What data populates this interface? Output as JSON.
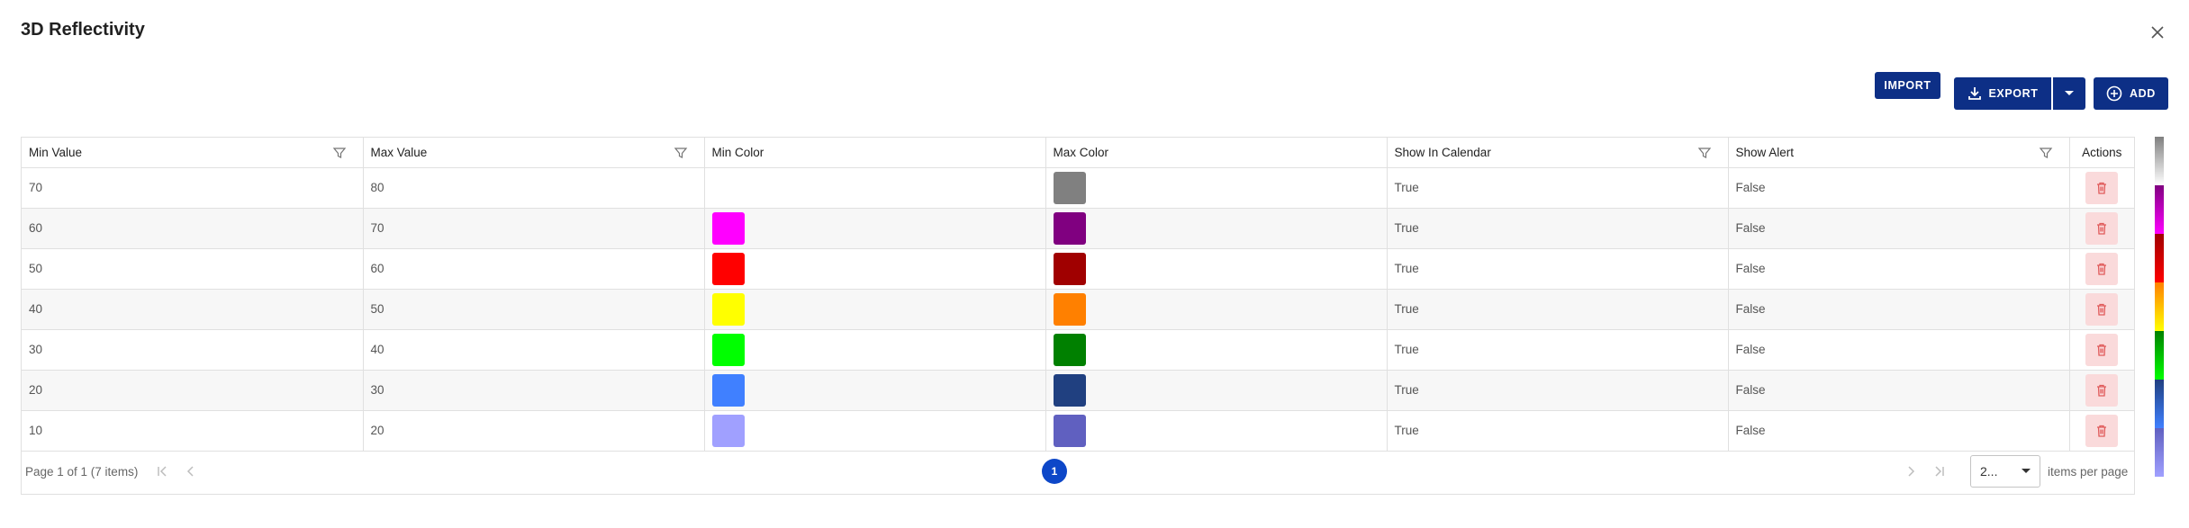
{
  "dialog": {
    "title": "3D Reflectivity"
  },
  "toolbar": {
    "import_label": "IMPORT",
    "export_label": "EXPORT",
    "add_label": "ADD"
  },
  "table": {
    "columns": [
      "Min Value",
      "Max Value",
      "Min Color",
      "Max Color",
      "Show In Calendar",
      "Show Alert",
      "Actions"
    ],
    "rows": [
      {
        "min_value": "70",
        "max_value": "80",
        "min_color": "",
        "max_color": "#808080",
        "show_in_calendar": "True",
        "show_alert": "False"
      },
      {
        "min_value": "60",
        "max_value": "70",
        "min_color": "#ff00ff",
        "max_color": "#800080",
        "show_in_calendar": "True",
        "show_alert": "False"
      },
      {
        "min_value": "50",
        "max_value": "60",
        "min_color": "#ff0000",
        "max_color": "#a00000",
        "show_in_calendar": "True",
        "show_alert": "False"
      },
      {
        "min_value": "40",
        "max_value": "50",
        "min_color": "#ffff00",
        "max_color": "#ff8000",
        "show_in_calendar": "True",
        "show_alert": "False"
      },
      {
        "min_value": "30",
        "max_value": "40",
        "min_color": "#00ff00",
        "max_color": "#008000",
        "show_in_calendar": "True",
        "show_alert": "False"
      },
      {
        "min_value": "20",
        "max_value": "30",
        "min_color": "#4080ff",
        "max_color": "#204080",
        "show_in_calendar": "True",
        "show_alert": "False"
      },
      {
        "min_value": "10",
        "max_value": "20",
        "min_color": "#a0a0ff",
        "max_color": "#6060c0",
        "show_in_calendar": "True",
        "show_alert": "False"
      }
    ]
  },
  "pager": {
    "info": "Page 1 of 1 (7 items)",
    "current_page": "1",
    "page_size": "2...",
    "per_page_label": "items per page"
  },
  "colors": {
    "primary": "#0d2f86",
    "page_active": "#0d47c8",
    "delete_bg": "#fadadb",
    "delete_icon": "#e05a5a"
  },
  "icons": {
    "close": "close-icon",
    "filter": "filter-icon",
    "export": "download-icon",
    "add": "plus-circle-icon",
    "delete": "trash-icon",
    "dropdown": "caret-down-icon"
  }
}
